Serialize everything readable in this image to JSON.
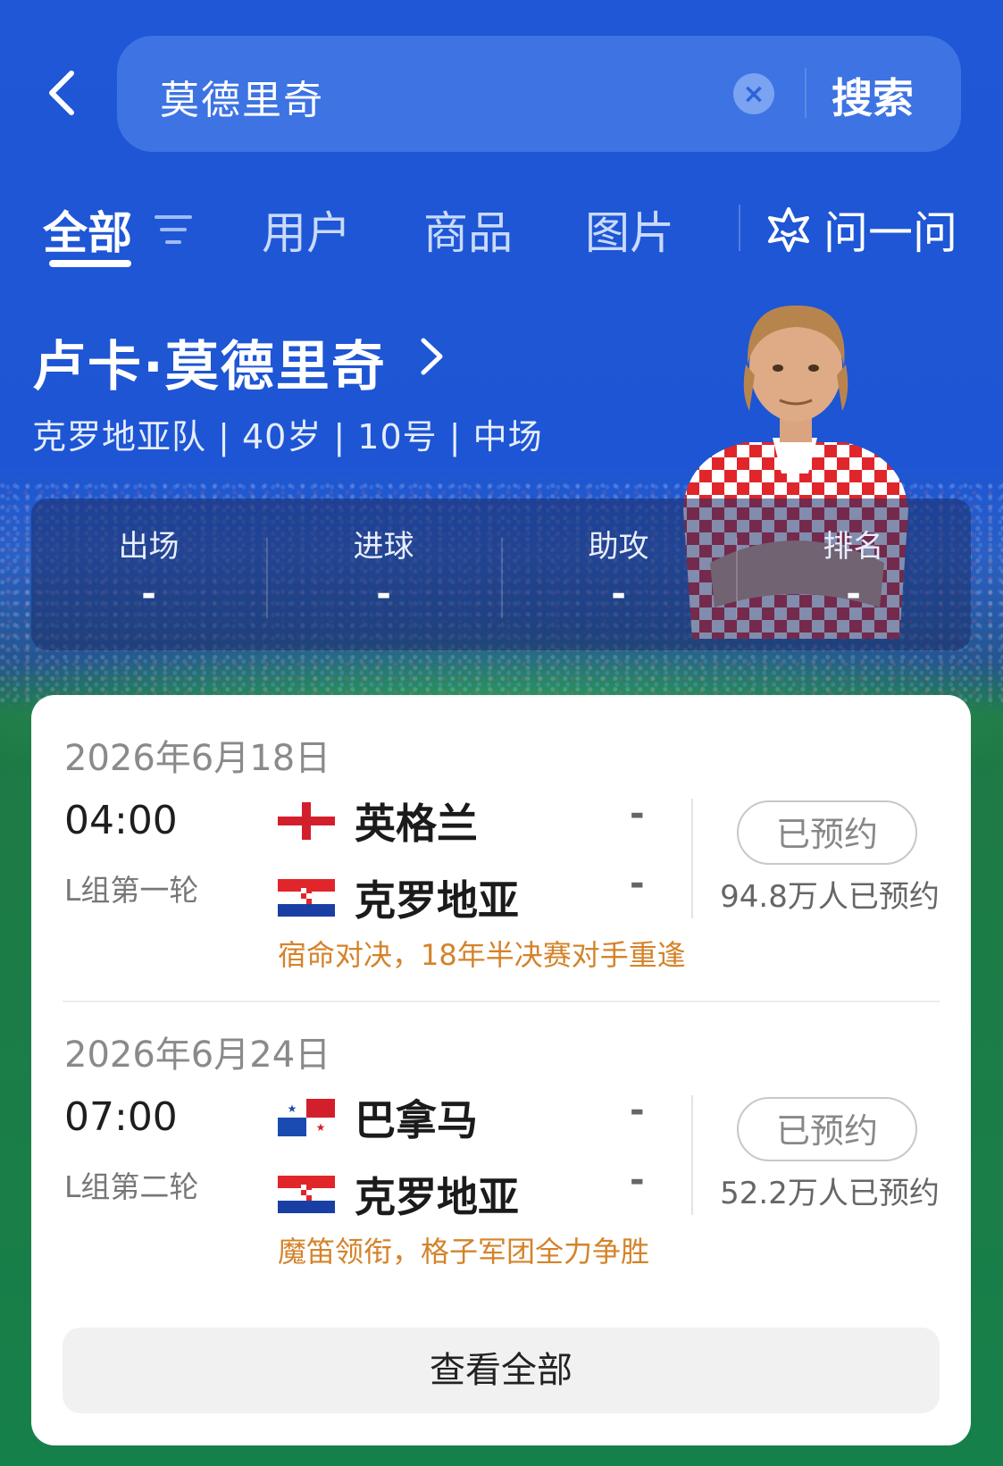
{
  "search": {
    "query": "莫德里奇",
    "button_label": "搜索"
  },
  "tabs": [
    {
      "label": "全部",
      "active": true
    },
    {
      "label": "用户",
      "active": false
    },
    {
      "label": "商品",
      "active": false
    },
    {
      "label": "图片",
      "active": false
    }
  ],
  "ask_label": "问一问",
  "player": {
    "name": "卢卡·莫德里奇",
    "info": "克罗地亚队 | 40岁 | 10号 | 中场"
  },
  "stats": [
    {
      "label": "出场",
      "value": "-"
    },
    {
      "label": "进球",
      "value": "-"
    },
    {
      "label": "助攻",
      "value": "-"
    },
    {
      "label": "排名",
      "value": "-"
    }
  ],
  "matches": [
    {
      "date": "2026年6月18日",
      "time": "04:00",
      "round": "L组第一轮",
      "home": {
        "name": "英格兰",
        "score": "-",
        "flag": "england-flag-icon"
      },
      "away": {
        "name": "克罗地亚",
        "score": "-",
        "flag": "croatia-flag-icon"
      },
      "reserve_label": "已预约",
      "reserve_count": "94.8万人已预约",
      "tagline": "宿命对决，18年半决赛对手重逢"
    },
    {
      "date": "2026年6月24日",
      "time": "07:00",
      "round": "L组第二轮",
      "home": {
        "name": "巴拿马",
        "score": "-",
        "flag": "panama-flag-icon"
      },
      "away": {
        "name": "克罗地亚",
        "score": "-",
        "flag": "croatia-flag-icon"
      },
      "reserve_label": "已预约",
      "reserve_count": "52.2万人已预约",
      "tagline": "魔笛领衔，格子军团全力争胜"
    }
  ],
  "view_all_label": "查看全部",
  "colors": {
    "primary_blue": "#1f57d6",
    "tagline_orange": "#d4832a",
    "pitch_green": "#16804a"
  }
}
